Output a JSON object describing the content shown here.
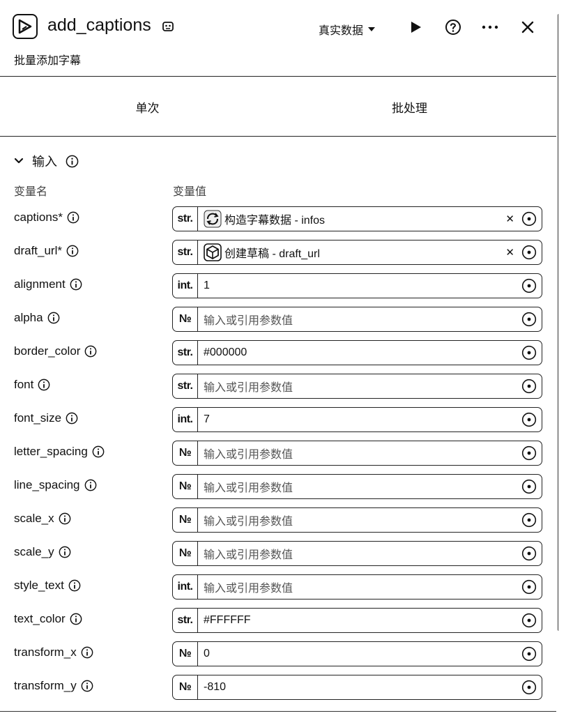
{
  "header": {
    "title": "add_captions",
    "subtitle": "批量添加字幕",
    "data_mode": "真实数据"
  },
  "tabs": [
    {
      "label": "单次"
    },
    {
      "label": "批处理"
    }
  ],
  "section": {
    "title": "输入",
    "col_name": "变量名",
    "col_value": "变量值"
  },
  "params": [
    {
      "name": "captions*",
      "type": "str.",
      "value": "构造字幕数据 - infos",
      "ref": true,
      "ref_icon": "refresh-icon",
      "clearable": true
    },
    {
      "name": "draft_url*",
      "type": "str.",
      "value": "创建草稿 - draft_url",
      "ref": true,
      "ref_icon": "cube-icon",
      "clearable": true
    },
    {
      "name": "alignment",
      "type": "int.",
      "value": "1"
    },
    {
      "name": "alpha",
      "type": "№",
      "placeholder": "输入或引用参数值"
    },
    {
      "name": "border_color",
      "type": "str.",
      "value": "#000000"
    },
    {
      "name": "font",
      "type": "str.",
      "placeholder": "输入或引用参数值"
    },
    {
      "name": "font_size",
      "type": "int.",
      "value": "7"
    },
    {
      "name": "letter_spacing",
      "type": "№",
      "placeholder": "输入或引用参数值"
    },
    {
      "name": "line_spacing",
      "type": "№",
      "placeholder": "输入或引用参数值"
    },
    {
      "name": "scale_x",
      "type": "№",
      "placeholder": "输入或引用参数值"
    },
    {
      "name": "scale_y",
      "type": "№",
      "placeholder": "输入或引用参数值"
    },
    {
      "name": "style_text",
      "type": "int.",
      "placeholder": "输入或引用参数值"
    },
    {
      "name": "text_color",
      "type": "str.",
      "value": "#FFFFFF"
    },
    {
      "name": "transform_x",
      "type": "№",
      "value": "0"
    },
    {
      "name": "transform_y",
      "type": "№",
      "value": "-810"
    }
  ]
}
